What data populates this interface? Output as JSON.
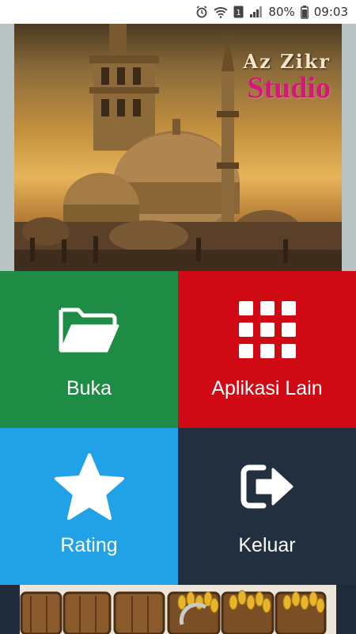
{
  "status_bar": {
    "icons": [
      "alarm-icon",
      "wifi-icon",
      "sim-1-icon",
      "signal-icon",
      "battery-icon"
    ],
    "sim_label": "1",
    "battery_percent": "80%",
    "time": "09:03"
  },
  "banner": {
    "logo_line1": "Az Zikr",
    "logo_line2": "Studio",
    "brand_color": "#d8157e"
  },
  "menu": {
    "open_label": "Buka",
    "apps_label": "Aplikasi Lain",
    "rating_label": "Rating",
    "exit_label": "Keluar",
    "colors": {
      "open": "#1e8c45",
      "apps": "#cf0a15",
      "rating": "#22a2e6",
      "exit": "#222f3e"
    }
  }
}
